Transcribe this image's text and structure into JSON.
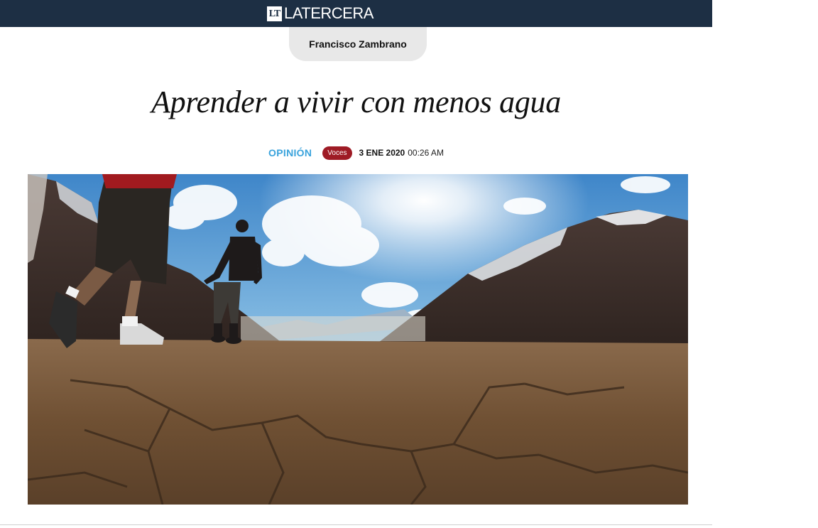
{
  "header": {
    "logo_mark": "LT",
    "logo_text": "LATERCERA",
    "background_color": "#1d2f44"
  },
  "author": {
    "name": "Francisco Zambrano"
  },
  "article": {
    "title": "Aprender a vivir con menos agua",
    "section": "OPINIÓN",
    "tag": "Voces",
    "date": "3 ENE 2020",
    "time": "00:26 AM"
  },
  "hero_image": {
    "alt": "Dry cracked ground in a mountain valley with people walking",
    "icon": "photo-icon"
  },
  "colors": {
    "accent_section": "#3aa3dc",
    "tag_background": "#9e1b25",
    "author_pill_background": "#e8e8e8"
  }
}
